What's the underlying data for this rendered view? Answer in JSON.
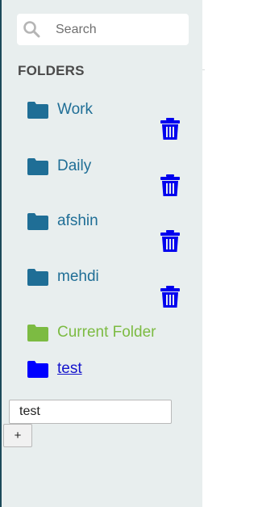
{
  "search": {
    "placeholder": "Search",
    "icon": "search-icon"
  },
  "folders_heading": "FOLDERS",
  "folders": [
    {
      "label": "Work",
      "icon": "folder-icon",
      "color": "#1f6e96",
      "deletable": true
    },
    {
      "label": "Daily",
      "icon": "folder-icon",
      "color": "#1f6e96",
      "deletable": true
    },
    {
      "label": "afshin",
      "icon": "folder-icon",
      "color": "#1f6e96",
      "deletable": true
    },
    {
      "label": "mehdi",
      "icon": "folder-icon",
      "color": "#1f6e96",
      "deletable": true
    },
    {
      "label": "Current Folder",
      "icon": "folder-icon",
      "color": "#7cbb42",
      "deletable": false
    },
    {
      "label": "test",
      "icon": "folder-icon",
      "color": "#0000ff",
      "deletable": false
    }
  ],
  "new_folder": {
    "value": "test",
    "add_label": "+"
  },
  "colors": {
    "sidebar_bg": "#e8eeee",
    "folder_blue": "#1f6e96",
    "current_green": "#7cbb42",
    "trash_blue": "#0000ee",
    "link_blue": "#1414cc"
  }
}
